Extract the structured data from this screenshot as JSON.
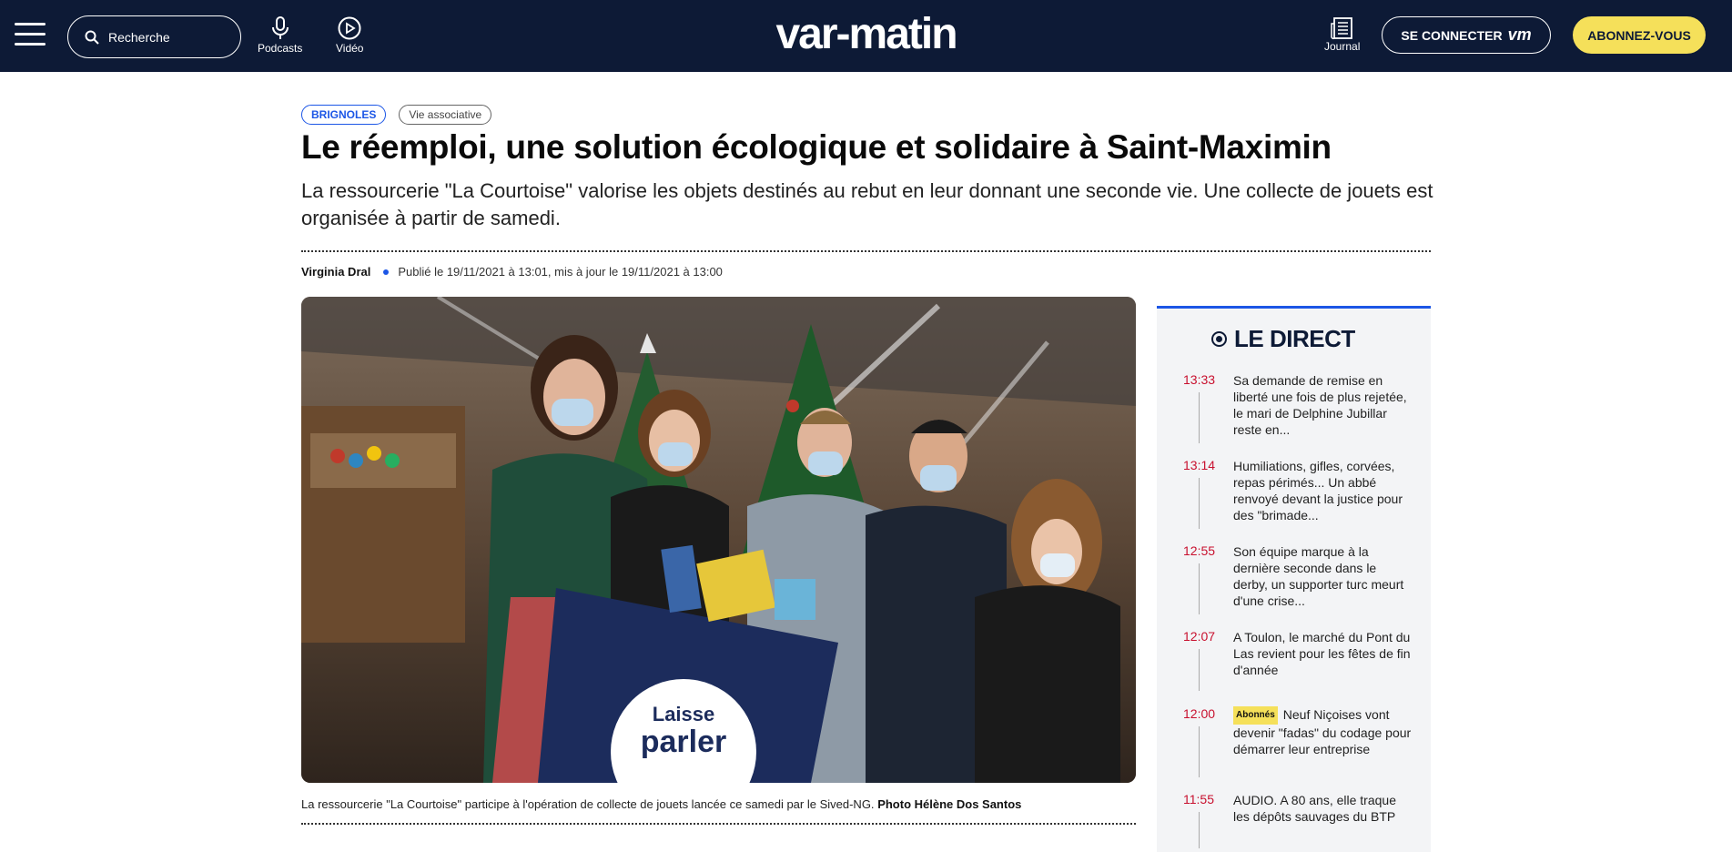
{
  "header": {
    "search_placeholder": "Recherche",
    "podcasts_label": "Podcasts",
    "video_label": "Vidéo",
    "logo_text": "var-matin",
    "journal_label": "Journal",
    "connect_label": "SE CONNECTER",
    "connect_brand": "vm",
    "subscribe_label": "ABONNEZ-VOUS",
    "colors": {
      "navbar": "#0d1a36",
      "subscribe": "#f5e05a",
      "accent": "#1c56e6"
    }
  },
  "article": {
    "tag_city": "BRIGNOLES",
    "tag_category": "Vie associative",
    "title": "Le réemploi, une solution écologique et solidaire à Saint-Maximin",
    "subtitle": "La ressourcerie \"La Courtoise\" valorise les objets destinés au rebut en leur donnant une seconde vie. Une collecte de jouets est organisée à partir de samedi.",
    "author": "Virginia Dral",
    "published": "Publié le 19/11/2021 à 13:01, mis à jour le 19/11/2021 à 13:00",
    "caption": "La ressourcerie \"La Courtoise\" participe à l'opération de collecte de jouets lancée ce samedi par le Sived-NG.",
    "photo_credit": "Photo Hélène Dos Santos",
    "photo_box_text": "Laisse parler ton coeur"
  },
  "direct": {
    "title": "LE DIRECT",
    "items": [
      {
        "time": "13:33",
        "text": "Sa demande de remise en liberté une fois de plus rejetée, le mari de Delphine Jubillar reste en..."
      },
      {
        "time": "13:14",
        "text": "Humiliations, gifles, corvées, repas périmés... Un abbé renvoyé devant la justice pour des \"brimade..."
      },
      {
        "time": "12:55",
        "text": "Son équipe marque à la dernière seconde dans le derby, un supporter turc meurt d'une crise..."
      },
      {
        "time": "12:07",
        "text": "A Toulon, le marché du Pont du Las revient pour les fêtes de fin d'année"
      },
      {
        "time": "12:00",
        "badge": "Abonnés",
        "text": "Neuf Niçoises vont devenir \"fadas\" du codage pour démarrer leur entreprise"
      },
      {
        "time": "11:55",
        "text": "AUDIO. A 80 ans, elle traque les dépôts sauvages du BTP"
      }
    ]
  }
}
